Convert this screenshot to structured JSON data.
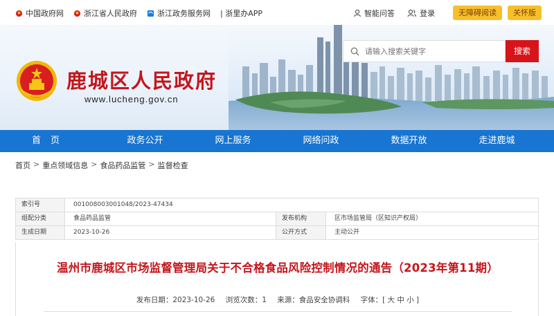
{
  "top_links": [
    {
      "label": "中国政府网",
      "icon": "emblem-icon"
    },
    {
      "label": "浙江省人民政府",
      "icon": "emblem-icon"
    },
    {
      "label": "浙江政务服务网",
      "icon": "service-icon"
    }
  ],
  "app_link": "| 浙里办APP",
  "top_right": {
    "ask": "智能问答",
    "login": "登录",
    "accessible": "无障碍阅读",
    "elder": "关怀版"
  },
  "site": {
    "title": "鹿城区人民政府",
    "url": "www.lucheng.gov.cn"
  },
  "search": {
    "placeholder": "请输入搜索关键字",
    "button": "搜索"
  },
  "nav": [
    "首页",
    "政务公开",
    "网上服务",
    "网络问政",
    "数据开放",
    "走进鹿城"
  ],
  "breadcrumb": [
    "首页",
    "重点领域信息",
    "食品药品监管",
    "监督检查"
  ],
  "info": {
    "index_label": "索引号",
    "index_value": "001008003001048/2023-47434",
    "category_label": "组配分类",
    "category_value": "食品药品监管",
    "org_label": "发布机构",
    "org_value": "区市场监管局（区知识产权局）",
    "date_label": "生成日期",
    "date_value": "2023-10-26",
    "mode_label": "公开方式",
    "mode_value": "主动公开"
  },
  "article": {
    "title": "温州市鹿城区市场监督管理局关于不合格食品风险控制情况的通告（2023年第11期）",
    "publish_date": "发布日期：2023-10-26",
    "views": "浏览次数：1",
    "source": "来源：食品安全协调科",
    "font_size": "字体：[ 大 中 小 ]"
  },
  "colors": {
    "brand_red": "#c4161c",
    "nav_blue": "#1875d1",
    "button_yellow": "#f7c02b",
    "search_red": "#d7141a"
  }
}
